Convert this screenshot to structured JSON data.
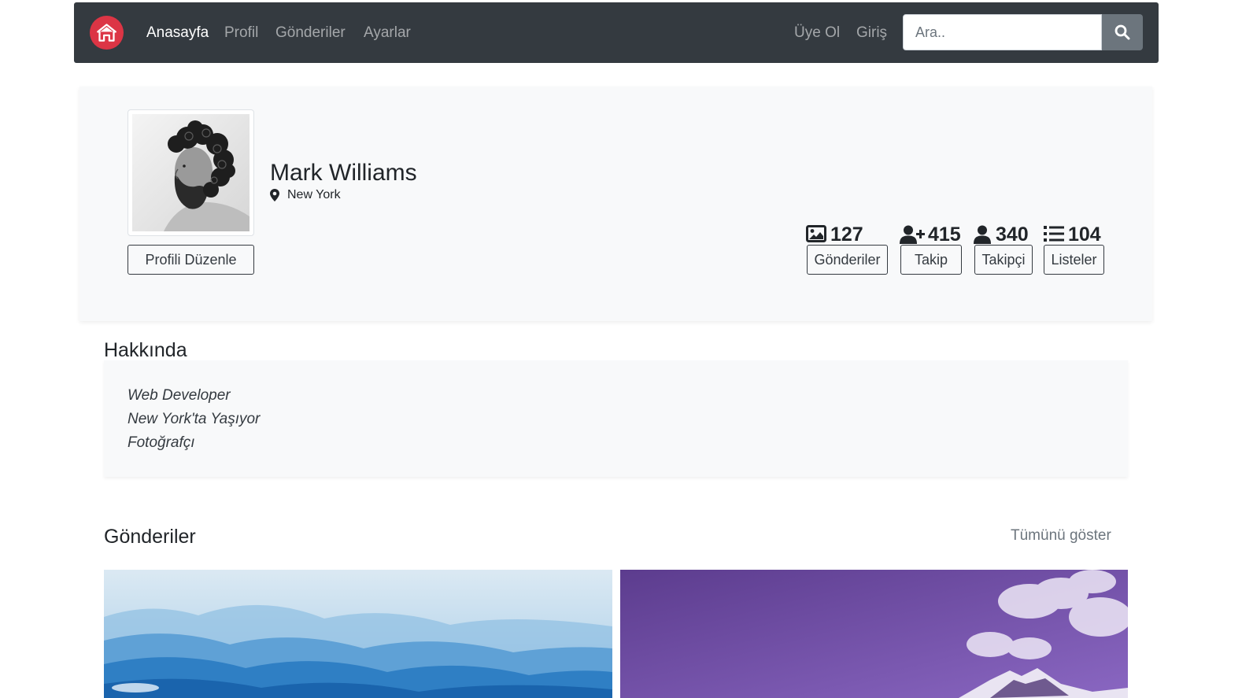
{
  "navbar": {
    "brand_icon": "home-icon",
    "brand_color": "#dc3545",
    "links": [
      {
        "label": "Anasayfa",
        "active": true
      },
      {
        "label": "Profil",
        "active": false
      },
      {
        "label": "Gönderiler",
        "active": false
      },
      {
        "label": "Ayarlar",
        "active": false
      }
    ],
    "auth": {
      "signup": "Üye Ol",
      "login": "Giriş"
    },
    "search": {
      "placeholder": "Ara..",
      "value": "",
      "button_icon": "search-icon"
    }
  },
  "profile": {
    "name": "Mark Williams",
    "location": "New York",
    "edit_button": "Profili Düzenle",
    "stats": [
      {
        "icon": "images-icon",
        "count": "127",
        "label": "Gönderiler"
      },
      {
        "icon": "user-plus-icon",
        "count": "415",
        "label": "Takip"
      },
      {
        "icon": "user-icon",
        "count": "340",
        "label": "Takipçi"
      },
      {
        "icon": "list-icon",
        "count": "104",
        "label": "Listeler"
      }
    ]
  },
  "about": {
    "title": "Hakkında",
    "lines": [
      "Web Developer",
      "New York'ta Yaşıyor",
      "Fotoğrafçı"
    ]
  },
  "posts": {
    "title": "Gönderiler",
    "show_all": "Tümünü göster"
  },
  "colors": {
    "navbar_bg": "#343a40",
    "card_bg": "#f8f9fa",
    "search_button": "#6c757d"
  }
}
